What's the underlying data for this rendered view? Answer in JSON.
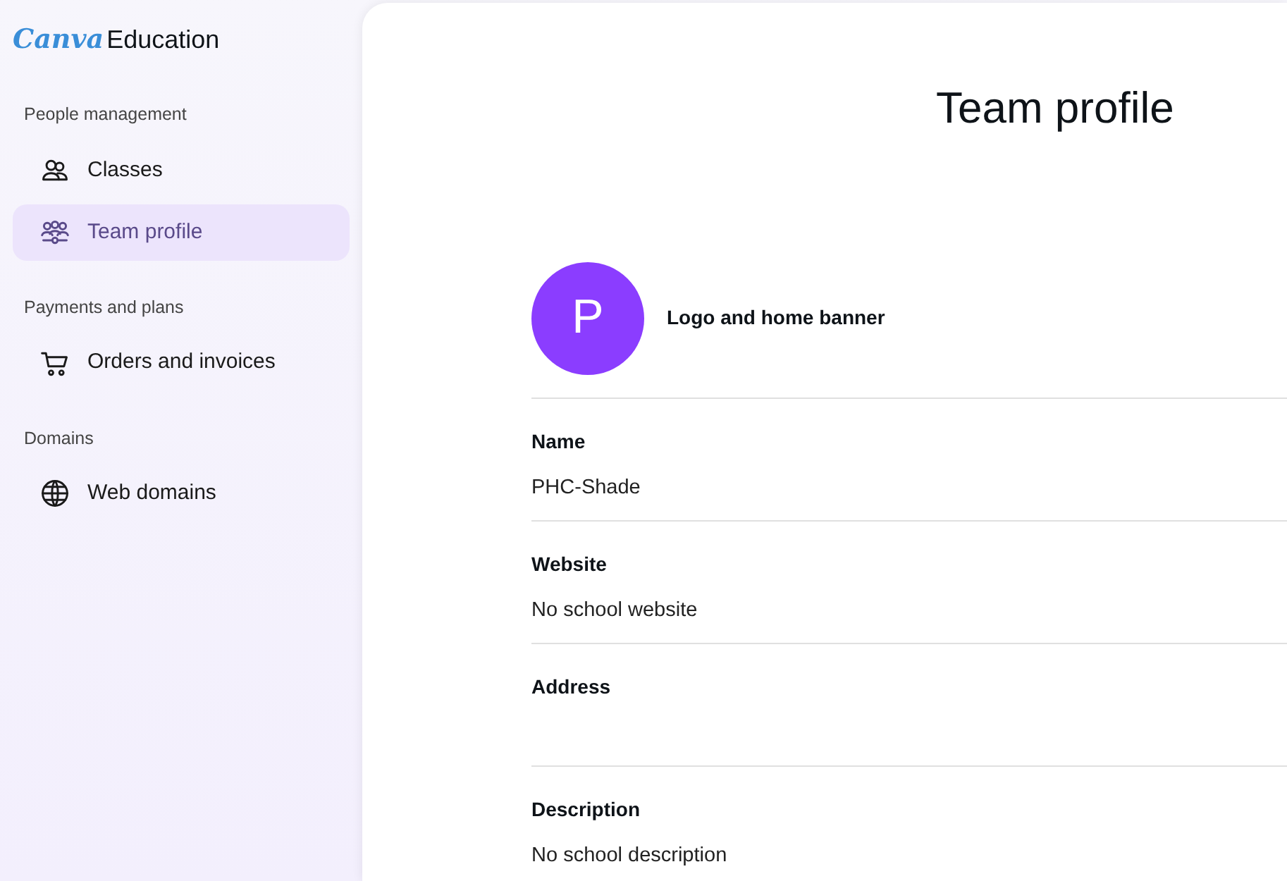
{
  "brand": {
    "logo": "Canva",
    "product": "Education"
  },
  "sidebar": {
    "sections": [
      {
        "heading": "People management",
        "items": [
          {
            "label": "Classes",
            "kind": "people",
            "selected": false
          },
          {
            "label": "Team profile",
            "kind": "team",
            "selected": true
          }
        ]
      },
      {
        "heading": "Payments and plans",
        "items": [
          {
            "label": "Orders and invoices",
            "kind": "cart",
            "selected": false
          }
        ]
      },
      {
        "heading": "Domains",
        "items": [
          {
            "label": "Web domains",
            "kind": "globe",
            "selected": false
          }
        ]
      }
    ]
  },
  "main": {
    "title": "Team profile",
    "avatar": {
      "letter": "P",
      "color": "#8b3dff"
    },
    "logo_label": "Logo and home banner",
    "fields": [
      {
        "label": "Name",
        "value": "PHC-Shade"
      },
      {
        "label": "Website",
        "value": "No school website"
      },
      {
        "label": "Address"
      },
      {
        "label": "Description",
        "value": "No school description"
      }
    ]
  }
}
